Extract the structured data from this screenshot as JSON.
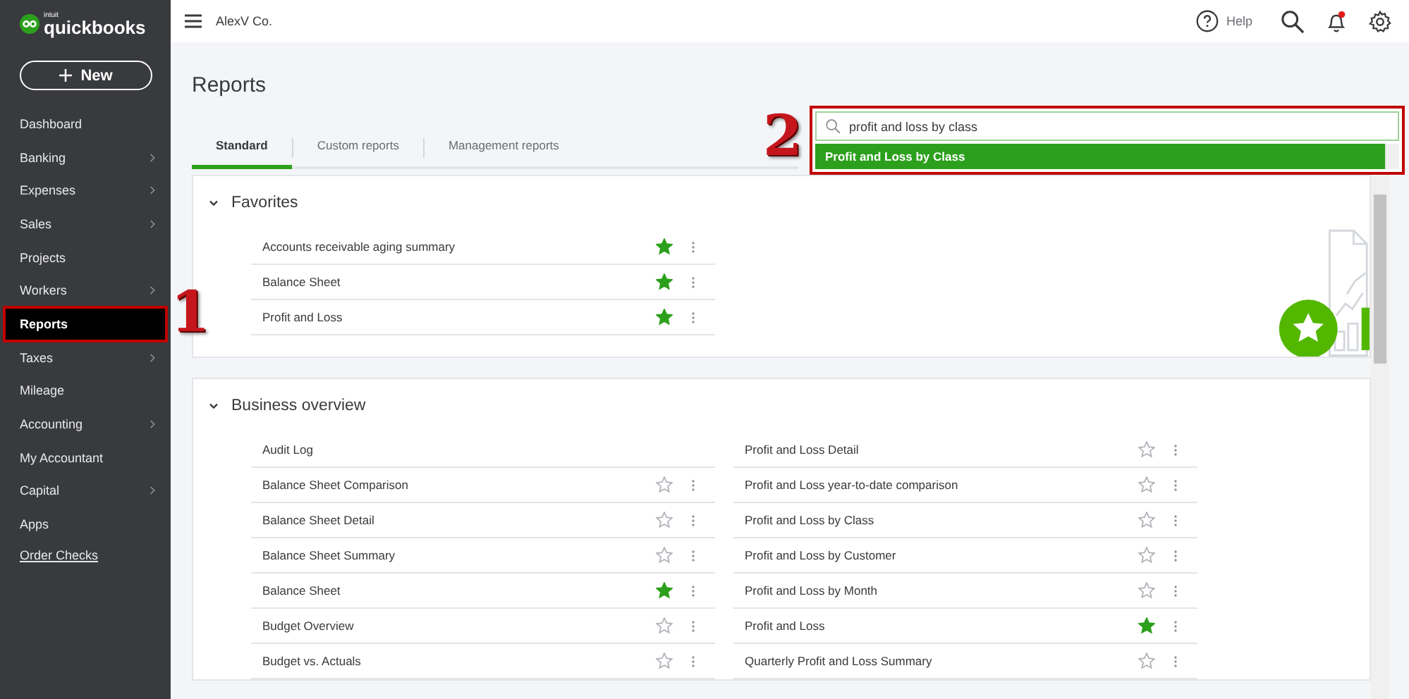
{
  "brand": {
    "small": "intuit",
    "name": "quickbooks"
  },
  "new_button": "New",
  "sidebar": {
    "items": [
      {
        "label": "Dashboard",
        "arrow": false,
        "selected": false
      },
      {
        "label": "Banking",
        "arrow": true,
        "selected": false
      },
      {
        "label": "Expenses",
        "arrow": true,
        "selected": false
      },
      {
        "label": "Sales",
        "arrow": true,
        "selected": false
      },
      {
        "label": "Projects",
        "arrow": false,
        "selected": false
      },
      {
        "label": "Workers",
        "arrow": true,
        "selected": false
      },
      {
        "label": "Reports",
        "arrow": false,
        "selected": true
      },
      {
        "label": "Taxes",
        "arrow": true,
        "selected": false
      },
      {
        "label": "Mileage",
        "arrow": false,
        "selected": false
      },
      {
        "label": "Accounting",
        "arrow": true,
        "selected": false
      },
      {
        "label": "My Accountant",
        "arrow": false,
        "selected": false
      },
      {
        "label": "Capital",
        "arrow": true,
        "selected": false
      },
      {
        "label": "Apps",
        "arrow": false,
        "selected": false
      }
    ],
    "link": "Order Checks"
  },
  "topbar": {
    "company": "AlexV Co.",
    "help": "Help",
    "notification": true
  },
  "page_title": "Reports",
  "tabs": [
    {
      "label": "Standard",
      "selected": true
    },
    {
      "label": "Custom reports",
      "selected": false
    },
    {
      "label": "Management reports",
      "selected": false
    }
  ],
  "search": {
    "value": "profit and loss by class",
    "suggestions": [
      {
        "label": "Profit and Loss by Class",
        "selected": true
      }
    ]
  },
  "annotations": [
    {
      "label": "1"
    },
    {
      "label": "2"
    }
  ],
  "favorites": {
    "title": "Favorites",
    "expanded": true,
    "rows": [
      {
        "label": "Accounts receivable aging summary",
        "favorite": true
      },
      {
        "label": "Balance Sheet",
        "favorite": true
      },
      {
        "label": "Profit and Loss",
        "favorite": true
      }
    ]
  },
  "business_overview": {
    "title": "Business overview",
    "expanded": true,
    "columns": [
      [
        {
          "label": "Audit Log"
        },
        {
          "label": "Balance Sheet Comparison",
          "favorite": false
        },
        {
          "label": "Balance Sheet Detail",
          "favorite": false
        },
        {
          "label": "Balance Sheet Summary",
          "favorite": false
        },
        {
          "label": "Balance Sheet",
          "favorite": true
        },
        {
          "label": "Budget Overview",
          "favorite": false
        },
        {
          "label": "Budget vs. Actuals",
          "favorite": false
        }
      ],
      [
        {
          "label": "Profit and Loss Detail",
          "favorite": false
        },
        {
          "label": "Profit and Loss year-to-date comparison",
          "favorite": false
        },
        {
          "label": "Profit and Loss by Class",
          "favorite": false
        },
        {
          "label": "Profit and Loss by Customer",
          "favorite": false
        },
        {
          "label": "Profit and Loss by Month",
          "favorite": false
        },
        {
          "label": "Profit and Loss",
          "favorite": true
        },
        {
          "label": "Quarterly Profit and Loss Summary",
          "favorite": false
        }
      ]
    ]
  }
}
